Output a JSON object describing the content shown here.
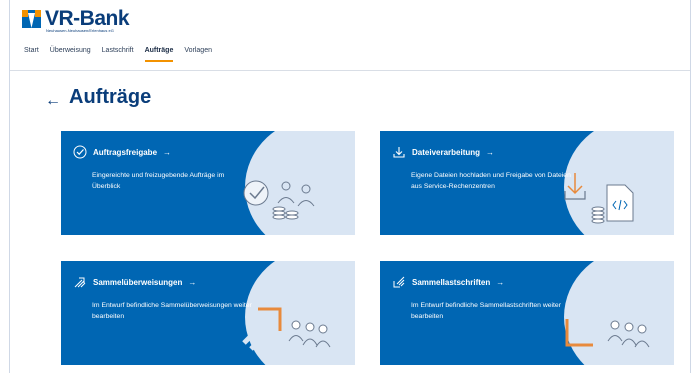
{
  "brand": {
    "name": "VR-Bank",
    "subline": "Neuhausen-Neuhausen/Erlenhaus eG"
  },
  "nav": {
    "items": [
      "Start",
      "Überweisung",
      "Lastschrift",
      "Aufträge",
      "Vorlagen"
    ],
    "active": "Aufträge"
  },
  "page": {
    "back_icon": "←",
    "title": "Aufträge"
  },
  "cards": [
    {
      "title": "Auftragsfreigabe",
      "arrow": "→",
      "icon": "check-circle-icon",
      "description": "Eingereichte und freizugebende Aufträge im Überblick"
    },
    {
      "title": "Dateiverarbeitung",
      "arrow": "→",
      "icon": "download-tray-icon",
      "description": "Eigene Dateien hochladen und Freigabe von Dateien aus Service-Rechenzentren"
    },
    {
      "title": "Sammelüberweisungen",
      "arrow": "→",
      "icon": "multi-arrow-up-icon",
      "description": "Im Entwurf befindliche Sammelüberweisungen weiter bearbeiten"
    },
    {
      "title": "Sammellastschriften",
      "arrow": "→",
      "icon": "multi-arrow-down-icon",
      "description": "Im Entwurf befindliche Sammellastschriften weiter bearbeiten"
    }
  ],
  "colors": {
    "brand_blue": "#0066b3",
    "brand_orange": "#f39200",
    "title_navy": "#0a3d7a",
    "card_blob": "#d9e5f3"
  }
}
